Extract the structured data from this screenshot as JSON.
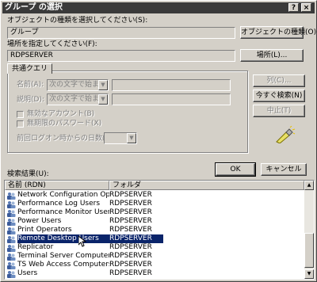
{
  "window": {
    "title": "グループ の選択",
    "help_label": "?",
    "close_label": "×"
  },
  "object_type": {
    "label": "オブジェクトの種類を選択してください(S):",
    "value": "グループ",
    "button": "オブジェクトの種類(O)..."
  },
  "location": {
    "label": "場所を指定してください(F):",
    "value": "RDPSERVER",
    "button": "場所(L)..."
  },
  "query": {
    "tab": "共通クエリ",
    "name_label": "名前(A):",
    "desc_label": "説明(D):",
    "name_mode": "次の文字で始まる",
    "desc_mode": "次の文字で始まる",
    "disabled_accounts": "無効なアカウント(B)",
    "non_expiring_pw": "無期限のパスワード(X)",
    "days_label": "前回ログオン時からの日数(I):",
    "columns_button": "列(C)...",
    "find_now_button": "今すぐ検索(N)",
    "stop_button": "中止(T)",
    "search_icon": "search-flashlight-icon"
  },
  "actions": {
    "ok": "OK",
    "cancel": "キャンセル"
  },
  "results": {
    "label": "検索結果(U):",
    "columns": [
      "名前 (RDN)",
      "フォルダ"
    ],
    "rows": [
      {
        "name": "Network Configuration Operators",
        "folder": "RDPSERVER"
      },
      {
        "name": "Performance Log Users",
        "folder": "RDPSERVER"
      },
      {
        "name": "Performance Monitor Users",
        "folder": "RDPSERVER"
      },
      {
        "name": "Power Users",
        "folder": "RDPSERVER"
      },
      {
        "name": "Print Operators",
        "folder": "RDPSERVER"
      },
      {
        "name": "Remote Desktop Users",
        "folder": "RDPSERVER"
      },
      {
        "name": "Replicator",
        "folder": "RDPSERVER"
      },
      {
        "name": "Terminal Server Computers",
        "folder": "RDPSERVER"
      },
      {
        "name": "TS Web Access Computers",
        "folder": "RDPSERVER"
      },
      {
        "name": "Users",
        "folder": "RDPSERVER"
      }
    ],
    "selected_row": "Remote Desktop Users",
    "row_icon": "group-icon",
    "scroll_up": "▲",
    "scroll_down": "▼"
  },
  "colors": {
    "dialog": "#d4d0c8",
    "titlebar": "#3a3a3a",
    "selection": "#0a246a"
  }
}
